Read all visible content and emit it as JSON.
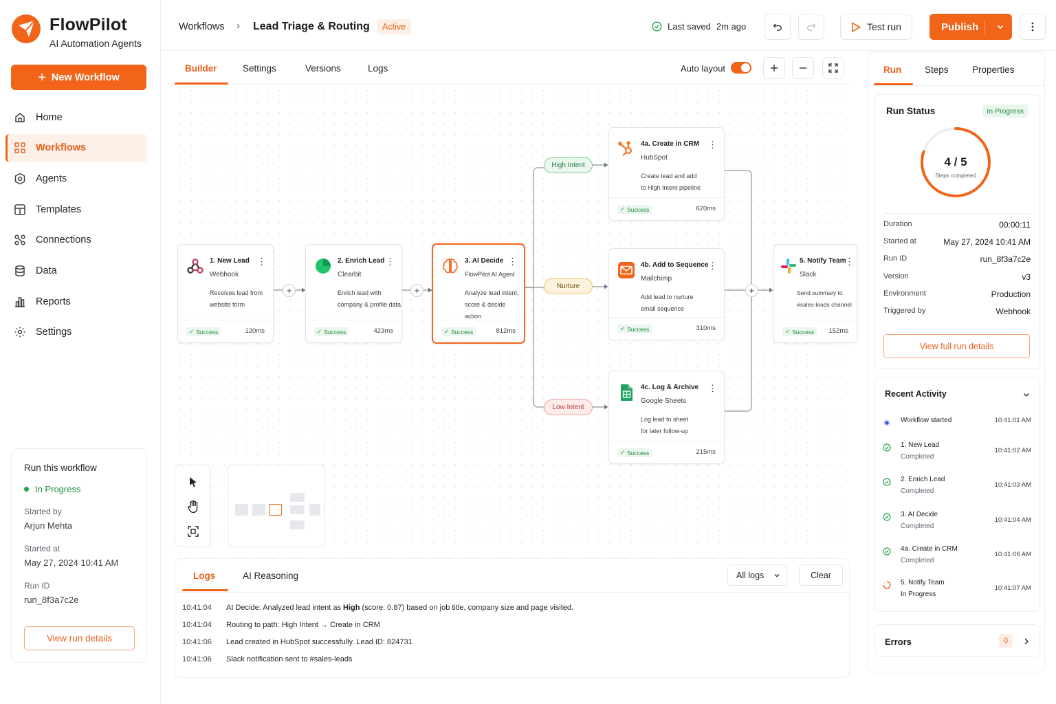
{
  "brand": {
    "name": "FlowPilot",
    "tagline": "AI Automation Agents"
  },
  "sidebar": {
    "new_button": "New Workflow",
    "items": [
      {
        "label": "Home",
        "icon": "home-icon",
        "active": false
      },
      {
        "label": "Workflows",
        "icon": "workflows-icon",
        "active": true
      },
      {
        "label": "Agents",
        "icon": "agents-icon",
        "active": false
      },
      {
        "label": "Templates",
        "icon": "templates-icon",
        "active": false
      },
      {
        "label": "Connections",
        "icon": "connections-icon",
        "active": false
      },
      {
        "label": "Data",
        "icon": "database-icon",
        "active": false
      },
      {
        "label": "Reports",
        "icon": "reports-icon",
        "active": false
      },
      {
        "label": "Settings",
        "icon": "gear-icon",
        "active": false
      }
    ],
    "run_card": {
      "title": "Run this workflow",
      "status": "In Progress",
      "started_by_label": "Started by",
      "started_by": "Arjun Mehta",
      "started_at_label": "Started at",
      "started_at": "May 27, 2024 10:41 AM",
      "run_id_label": "Run ID",
      "run_id": "run_8f3a7c2e",
      "button": "View run details"
    }
  },
  "header": {
    "crumb_root": "Workflows",
    "crumb_sep": "›",
    "title": "Lead Triage & Routing",
    "status": "Active",
    "saved_label": "Last saved",
    "saved_time": "2m ago",
    "test_run": "Test run",
    "publish": "Publish"
  },
  "builder_tabs": [
    "Builder",
    "Settings",
    "Versions",
    "Logs"
  ],
  "auto_layout": "Auto layout",
  "nodes": {
    "n1": {
      "title": "1. New Lead",
      "sub": "Webhook",
      "desc": "Receives lead from\nwebsite form",
      "status": "Success",
      "time": "120ms"
    },
    "n2": {
      "title": "2. Enrich Lead",
      "sub": "Clearbit",
      "desc": "Enrich lead with\ncompany & profile data",
      "status": "Success",
      "time": "423ms"
    },
    "n3": {
      "title": "3. AI Decide",
      "sub": "FlowPilot AI Agent",
      "desc": "Analyze lead intent,\nscore & decide action",
      "status": "Success",
      "time": "812ms"
    },
    "n4a": {
      "title": "4a. Create in CRM",
      "sub": "HubSpot",
      "desc": "Create lead and add\nto High Intent pipeline",
      "status": "Success",
      "time": "620ms"
    },
    "n4b": {
      "title": "4b. Add to Sequence",
      "sub": "Mailchimp",
      "desc": "Add lead to nurture\nemail sequence",
      "status": "Success",
      "time": "310ms"
    },
    "n4c": {
      "title": "4c. Log & Archive",
      "sub": "Google Sheets",
      "desc": "Log lead to sheet\nfor later follow-up",
      "status": "Success",
      "time": "215ms"
    },
    "n5": {
      "title": "5. Notify Team",
      "sub": "Slack",
      "desc": "Send summary to\n#sales-leads channel",
      "status": "Success",
      "time": "152ms"
    }
  },
  "branches": {
    "high": "High Intent",
    "nurture": "Nurture",
    "low": "Low Intent"
  },
  "logs": {
    "tabs": [
      "Logs",
      "AI Reasoning"
    ],
    "filter": "All logs",
    "clear": "Clear",
    "rows": [
      {
        "time": "10:41:04",
        "pre": "AI Decide: Analyzed lead intent as ",
        "bold": "High",
        "post": " (score: 0.87) based on job title, company size and page visited."
      },
      {
        "time": "10:41:04",
        "pre": "Routing to path: High Intent  →  Create in CRM",
        "bold": "",
        "post": ""
      },
      {
        "time": "10:41:06",
        "pre": "Lead created in HubSpot successfully. Lead ID: 824731",
        "bold": "",
        "post": ""
      },
      {
        "time": "10:41:06",
        "pre": "Slack notification sent to #sales-leads",
        "bold": "",
        "post": ""
      }
    ]
  },
  "right_panel": {
    "tabs": [
      "Run",
      "Steps",
      "Properties"
    ],
    "run_status": {
      "title": "Run Status",
      "badge": "In Progress",
      "progress_text": "4 / 5",
      "progress_fraction": 0.8,
      "progress_sub": "Steps completed",
      "fields": [
        {
          "k": "Duration",
          "v": "00:00:11"
        },
        {
          "k": "Started at",
          "v": "May 27, 2024 10:41 AM"
        },
        {
          "k": "Run ID",
          "v": "run_8f3a7c2e"
        },
        {
          "k": "Version",
          "v": "v3"
        },
        {
          "k": "Environment",
          "v": "Production"
        },
        {
          "k": "Triggered by",
          "v": "Webhook"
        }
      ],
      "button": "View full run details"
    },
    "recent_activity": {
      "title": "Recent Activity",
      "items": [
        {
          "t1": "Workflow started",
          "t2": "",
          "time": "10:41:01 AM",
          "state": "started"
        },
        {
          "t1": "1. New Lead",
          "t2": "Completed",
          "time": "10:41:02 AM",
          "state": "done"
        },
        {
          "t1": "2. Enrich Lead",
          "t2": "Completed",
          "time": "10:41:03 AM",
          "state": "done"
        },
        {
          "t1": "3. AI Decide",
          "t2": "Completed",
          "time": "10:41:04 AM",
          "state": "done"
        },
        {
          "t1": "4a. Create in CRM",
          "t2": "Completed",
          "time": "10:41:06 AM",
          "state": "done"
        },
        {
          "t1": "5. Notify Team",
          "t2": "In Progress",
          "time": "10:41:07 AM",
          "state": "progress"
        }
      ]
    },
    "errors": {
      "title": "Errors",
      "count": "0"
    }
  },
  "colors": {
    "accent": "#f26419",
    "success": "#1e8e3e",
    "high": "#2e9a52",
    "nurture": "#d49a1a",
    "low": "#d9534f"
  }
}
